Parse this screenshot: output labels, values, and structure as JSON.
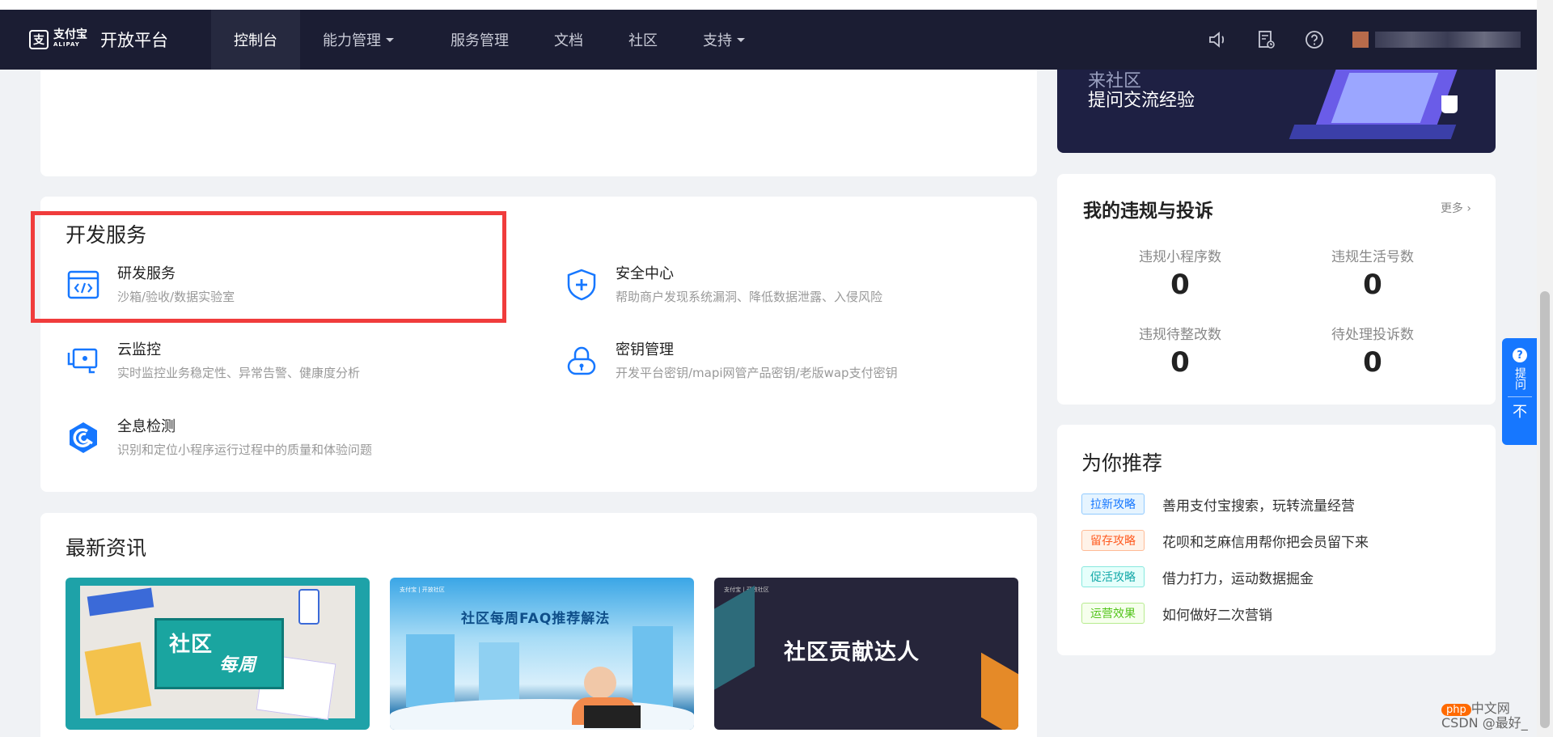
{
  "nav": {
    "logo_cn": "支付宝",
    "logo_en": "ALIPAY",
    "platform": "开放平台",
    "items": [
      {
        "label": "控制台",
        "active": true,
        "dropdown": false
      },
      {
        "label": "能力管理",
        "active": false,
        "dropdown": true
      },
      {
        "label": "服务管理",
        "active": false,
        "dropdown": false
      },
      {
        "label": "文档",
        "active": false,
        "dropdown": false
      },
      {
        "label": "社区",
        "active": false,
        "dropdown": false
      },
      {
        "label": "支持",
        "active": false,
        "dropdown": true
      }
    ],
    "icons": [
      "speaker-icon",
      "task-list-icon",
      "help-icon"
    ]
  },
  "dev_services": {
    "title": "开发服务",
    "items": [
      {
        "name": "研发服务",
        "desc": "沙箱/验收/数据实验室"
      },
      {
        "name": "安全中心",
        "desc": "帮助商户发现系统漏洞、降低数据泄露、入侵风险"
      },
      {
        "name": "云监控",
        "desc": "实时监控业务稳定性、异常告警、健康度分析"
      },
      {
        "name": "密钥管理",
        "desc": "开发平台密钥/mapi网管产品密钥/老版wap支付密钥"
      },
      {
        "name": "全息检测",
        "desc": "识别和定位小程序运行过程中的质量和体验问题"
      }
    ]
  },
  "news": {
    "title": "最新资讯",
    "cards": [
      {
        "text_1": "社区",
        "text_2": "每周"
      },
      {
        "text": "社区每周FAQ推荐解法",
        "header": "支付宝 | 开放社区"
      },
      {
        "text": "社区贡献达人",
        "header": "支付宝 | 开放社区"
      }
    ]
  },
  "banner": {
    "line_top": "来社区",
    "line_main": "提问交流经验"
  },
  "violations": {
    "title": "我的违规与投诉",
    "more": "更多",
    "stats": [
      {
        "label": "违规小程序数",
        "value": "0"
      },
      {
        "label": "违规生活号数",
        "value": "0"
      },
      {
        "label": "违规待整改数",
        "value": "0"
      },
      {
        "label": "待处理投诉数",
        "value": "0"
      }
    ]
  },
  "recommend": {
    "title": "为你推荐",
    "items": [
      {
        "tag": "拉新攻略",
        "text": "善用支付宝搜索，玩转流量经营",
        "color": "#1677ff"
      },
      {
        "tag": "留存攻略",
        "text": "花呗和芝麻信用帮你把会员留下来",
        "color": "#ff5a1f"
      },
      {
        "tag": "促活攻略",
        "text": "借力打力，运动数据掘金",
        "color": "#13a8a8"
      },
      {
        "tag": "运营效果",
        "text": "如何做好二次营销",
        "color": "#52c41a"
      }
    ]
  },
  "float_widget": {
    "ask": "提问",
    "top": "不"
  },
  "watermark": {
    "badge": "php",
    "text": "中文网",
    "csdn": "CSDN @最好_"
  }
}
